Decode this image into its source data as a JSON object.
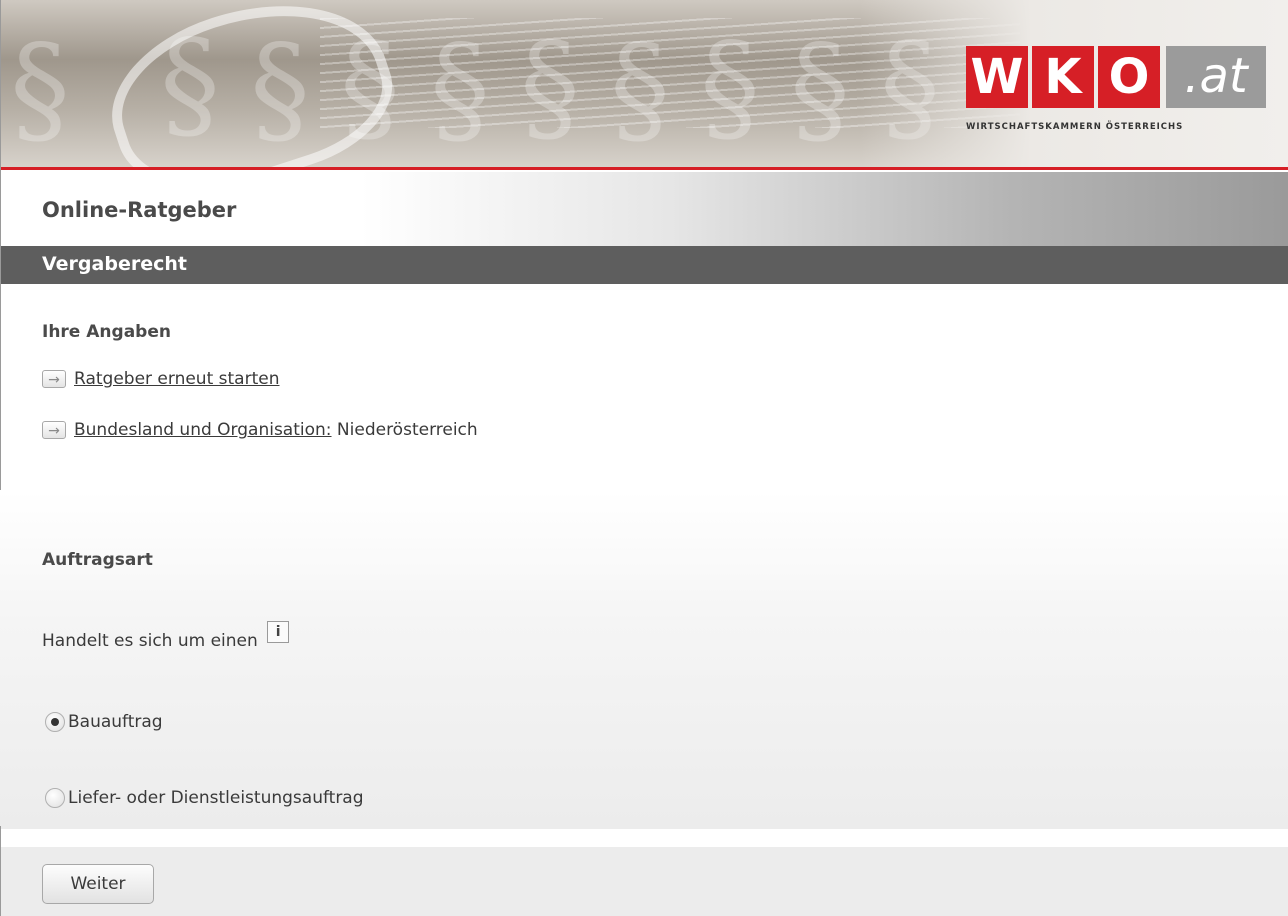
{
  "header": {
    "logo_letters": [
      "W",
      "K",
      "O"
    ],
    "logo_suffix": ".at",
    "logo_tagline": "WIRTSCHAFTSKAMMERN ÖSTERREICHS",
    "brand_color": "#d61f26"
  },
  "page": {
    "title": "Online-Ratgeber",
    "section": "Vergaberecht"
  },
  "angaben": {
    "heading": "Ihre Angaben",
    "restart_link": "Ratgeber erneut starten",
    "region_link": "Bundesland und Organisation:",
    "region_value": "Niederösterreich"
  },
  "question": {
    "heading": "Auftragsart",
    "prompt": "Handelt es sich um einen",
    "info_glyph": "i",
    "options": [
      {
        "label": "Bauauftrag",
        "selected": true
      },
      {
        "label": "Liefer- oder Dienstleistungsauftrag",
        "selected": false
      }
    ]
  },
  "footer": {
    "next_button": "Weiter"
  },
  "icons": {
    "arrow_glyph": "→"
  }
}
